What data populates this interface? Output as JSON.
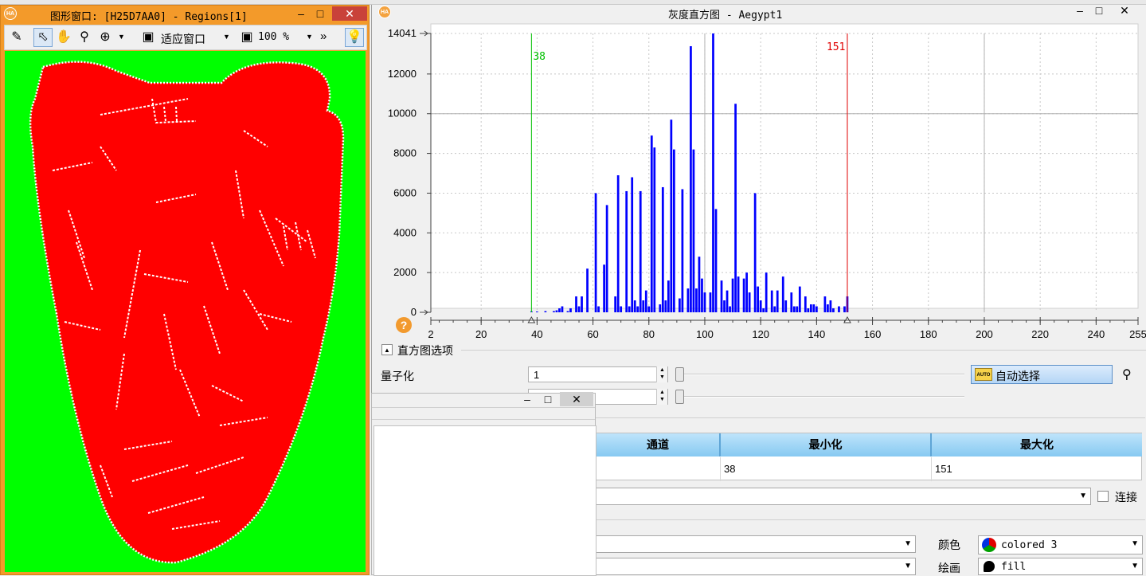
{
  "graphics_window": {
    "title": "图形窗口: [H25D7AA0] - Regions[1]",
    "app_badge": "HA",
    "fit_label": "适应窗口",
    "zoom_label": "100 %",
    "more": "»",
    "colors": {
      "frame": "#f39a2a",
      "background": "#00ff00",
      "region": "#ff0000",
      "edges": "#ffffff"
    }
  },
  "histogram_window": {
    "title": "灰度直方图 - Aegypt1",
    "app_badge": "HA",
    "help": "?",
    "options_section": "直方图选项",
    "quantize_label": "量子化",
    "quantize_value": "1",
    "auto_select_label": "自动选择",
    "auto_badge": "AUTO",
    "colors": {
      "bars": "#0000ff",
      "min_line": "#00c000",
      "max_line": "#e00000"
    }
  },
  "chart_data": {
    "type": "bar",
    "title": "",
    "xlabel": "",
    "ylabel": "",
    "xlim": [
      2,
      255
    ],
    "ylim": [
      0,
      14041
    ],
    "x_ticks": [
      2,
      20,
      40,
      60,
      80,
      100,
      120,
      140,
      160,
      180,
      200,
      220,
      240,
      255
    ],
    "y_ticks": [
      0,
      2000,
      4000,
      6000,
      8000,
      10000,
      12000,
      14041
    ],
    "y_tick_labels": [
      "0",
      "2000",
      "4000",
      "6000",
      "8000",
      "10000",
      "12000",
      "14041"
    ],
    "threshold_min": 38,
    "threshold_max": 151,
    "grid": true,
    "bins": [
      [
        38,
        50
      ],
      [
        40,
        40
      ],
      [
        43,
        60
      ],
      [
        46,
        60
      ],
      [
        47,
        100
      ],
      [
        48,
        200
      ],
      [
        49,
        300
      ],
      [
        51,
        60
      ],
      [
        52,
        200
      ],
      [
        54,
        800
      ],
      [
        55,
        300
      ],
      [
        56,
        800
      ],
      [
        58,
        2200
      ],
      [
        61,
        6000
      ],
      [
        62,
        300
      ],
      [
        64,
        2400
      ],
      [
        65,
        5400
      ],
      [
        68,
        800
      ],
      [
        69,
        6900
      ],
      [
        70,
        300
      ],
      [
        72,
        6100
      ],
      [
        73,
        300
      ],
      [
        74,
        6800
      ],
      [
        75,
        600
      ],
      [
        76,
        300
      ],
      [
        77,
        6100
      ],
      [
        78,
        600
      ],
      [
        79,
        1100
      ],
      [
        80,
        300
      ],
      [
        81,
        8900
      ],
      [
        82,
        8300
      ],
      [
        84,
        400
      ],
      [
        85,
        6300
      ],
      [
        86,
        600
      ],
      [
        87,
        1600
      ],
      [
        88,
        9700
      ],
      [
        89,
        8200
      ],
      [
        91,
        700
      ],
      [
        92,
        6200
      ],
      [
        94,
        1200
      ],
      [
        95,
        13400
      ],
      [
        96,
        8200
      ],
      [
        97,
        1200
      ],
      [
        98,
        2800
      ],
      [
        99,
        1700
      ],
      [
        100,
        1000
      ],
      [
        102,
        1000
      ],
      [
        103,
        14041
      ],
      [
        104,
        5200
      ],
      [
        106,
        1600
      ],
      [
        107,
        600
      ],
      [
        108,
        1100
      ],
      [
        109,
        300
      ],
      [
        110,
        1700
      ],
      [
        111,
        10500
      ],
      [
        112,
        1800
      ],
      [
        114,
        1700
      ],
      [
        115,
        2000
      ],
      [
        116,
        1000
      ],
      [
        118,
        6000
      ],
      [
        119,
        1300
      ],
      [
        120,
        600
      ],
      [
        121,
        200
      ],
      [
        122,
        2000
      ],
      [
        124,
        1100
      ],
      [
        125,
        300
      ],
      [
        126,
        1100
      ],
      [
        128,
        1800
      ],
      [
        129,
        600
      ],
      [
        131,
        1000
      ],
      [
        132,
        300
      ],
      [
        133,
        300
      ],
      [
        134,
        1300
      ],
      [
        136,
        800
      ],
      [
        137,
        200
      ],
      [
        138,
        400
      ],
      [
        139,
        400
      ],
      [
        140,
        300
      ],
      [
        143,
        800
      ],
      [
        144,
        400
      ],
      [
        145,
        600
      ],
      [
        146,
        200
      ],
      [
        148,
        300
      ],
      [
        150,
        300
      ],
      [
        151,
        800
      ]
    ]
  },
  "lower_panel": {
    "connect_label": "连接",
    "color_label": "颜色",
    "color_value": "colored 3",
    "draw_label": "绘画",
    "draw_value": "fill",
    "table": {
      "headers": [
        "通道",
        "最小化",
        "最大化"
      ],
      "rows": [
        [
          "",
          "38",
          "151"
        ]
      ]
    }
  }
}
